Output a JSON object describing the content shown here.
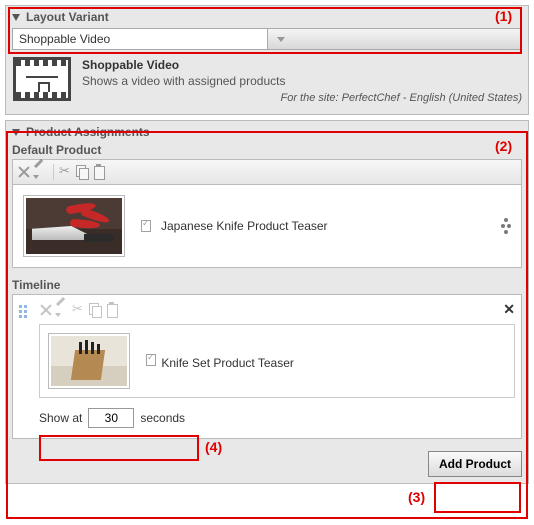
{
  "layoutVariant": {
    "header": "Layout Variant",
    "selected": "Shoppable Video",
    "title": "Shoppable Video",
    "subtitle": "Shows a video with assigned products",
    "siteLabel": "For the site: PerfectChef - English (United States)"
  },
  "productAssignments": {
    "header": "Product Assignments",
    "defaultLabel": "Default Product",
    "defaultTeaser": "Japanese Knife Product Teaser",
    "timelineLabel": "Timeline",
    "timelineTeaser": "Knife Set Product Teaser",
    "showAtPrefix": "Show at",
    "showAtValue": "30",
    "showAtSuffix": "seconds",
    "addProductLabel": "Add Product"
  },
  "annotations": {
    "a1": "(1)",
    "a2": "(2)",
    "a3": "(3)",
    "a4": "(4)"
  }
}
